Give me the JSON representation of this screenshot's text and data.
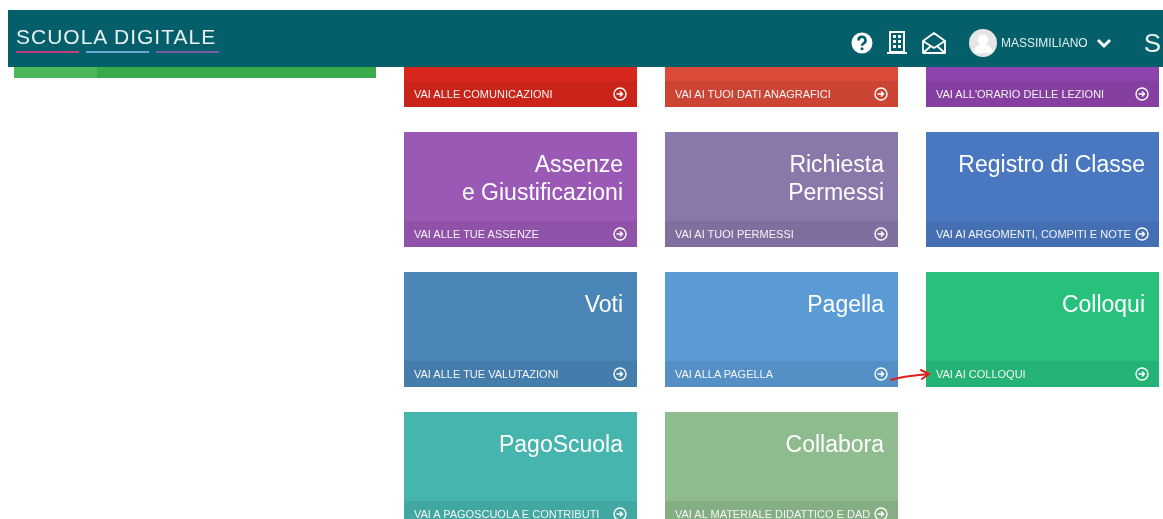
{
  "header": {
    "logo": "SCUOLA DIGITALE",
    "user": "MASSIMILIANO",
    "corner_logo": "S"
  },
  "progress": {
    "level": 0.23
  },
  "tiles": [
    {
      "link": "VAI ALLE COMUNICAZIONI",
      "color": "#d9261c",
      "arrow_marked": false
    },
    {
      "link": "VAI AI TUOI DATI ANAGRAFICI",
      "color": "#dc4a38",
      "arrow_marked": false
    },
    {
      "link": "VAI ALL'ORARIO DELLE LEZIONI",
      "color": "#8e44ad",
      "arrow_marked": false
    },
    {
      "title": "Assenze\ne Giustificazioni",
      "link": "VAI ALLE TUE ASSENZE",
      "color": "#9b59b6",
      "arrow_marked": false
    },
    {
      "title": "Richiesta\nPermessi",
      "link": "VAI AI TUOI PERMESSI",
      "color": "#8a78aa",
      "arrow_marked": false
    },
    {
      "title": "Registro di Classe",
      "link": "VAI AI ARGOMENTI, COMPITI E NOTE",
      "color": "#4a78c0",
      "arrow_marked": false
    },
    {
      "title": "Voti",
      "link": "VAI ALLE TUE VALUTAZIONI",
      "color": "#4a86b8",
      "arrow_marked": false
    },
    {
      "title": "Pagella",
      "link": "VAI ALLA PAGELLA",
      "color": "#5b9bd5",
      "arrow_marked": false
    },
    {
      "title": "Colloqui",
      "link": "VAI AI COLLOQUI",
      "color": "#27c17d",
      "arrow_marked": true
    },
    {
      "title": "PagoScuola",
      "link": "VAI A PAGOSCUOLA E CONTRIBUTI",
      "color": "#45b5ad",
      "arrow_marked": false
    },
    {
      "title": "Collabora",
      "link": "VAI AL MATERIALE DIDATTICO E DAD",
      "color": "#8fbc8f",
      "arrow_marked": false
    }
  ]
}
